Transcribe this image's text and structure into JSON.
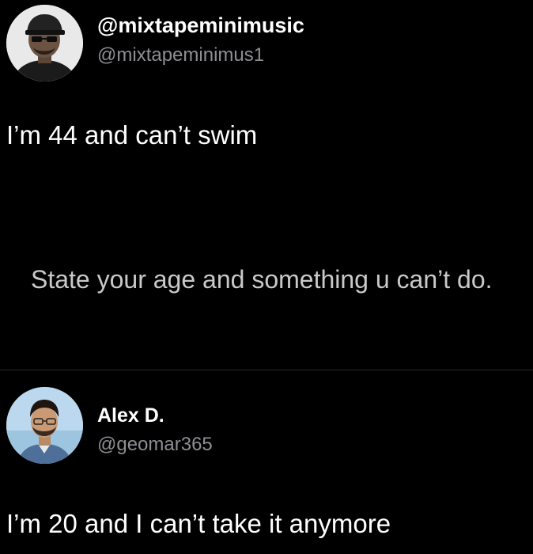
{
  "post1": {
    "display_name": "@mixtapeminimusic",
    "handle": "@mixtapeminimus1",
    "text": "I’m 44 and can’t swim",
    "avatar_icon": "user-avatar-icon"
  },
  "quoted": {
    "text": "State your age and something u can’t do."
  },
  "post2": {
    "display_name": "Alex D.",
    "handle": "@geomar365",
    "text": "I’m 20 and I can’t take it anymore",
    "avatar_icon": "user-avatar-icon"
  },
  "colors": {
    "background": "#000000",
    "primary_text": "#ffffff",
    "secondary_text": "#8e8e93",
    "quoted_text": "#c9c9c9"
  }
}
